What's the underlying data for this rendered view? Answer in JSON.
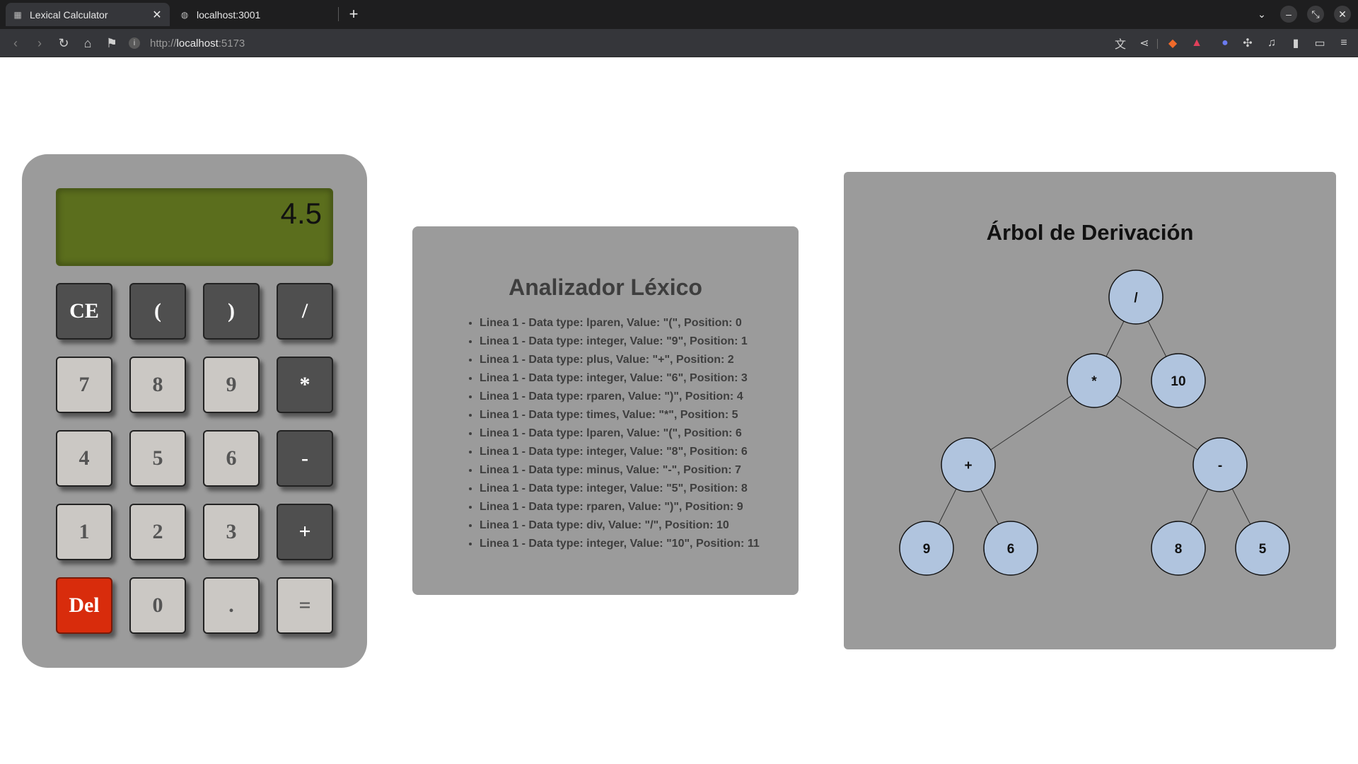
{
  "browser": {
    "tabs": [
      {
        "title": "Lexical Calculator",
        "active": true
      },
      {
        "title": "localhost:3001",
        "active": false
      }
    ],
    "url_prefix": "http://",
    "url_host": "localhost",
    "url_port": ":5173"
  },
  "calculator": {
    "display": "4.5",
    "keys": [
      {
        "label": "CE",
        "style": "dark"
      },
      {
        "label": "(",
        "style": "dark"
      },
      {
        "label": ")",
        "style": "dark"
      },
      {
        "label": "/",
        "style": "dark"
      },
      {
        "label": "7",
        "style": "light"
      },
      {
        "label": "8",
        "style": "light"
      },
      {
        "label": "9",
        "style": "light"
      },
      {
        "label": "*",
        "style": "dark"
      },
      {
        "label": "4",
        "style": "light"
      },
      {
        "label": "5",
        "style": "light"
      },
      {
        "label": "6",
        "style": "light"
      },
      {
        "label": "-",
        "style": "dark"
      },
      {
        "label": "1",
        "style": "light"
      },
      {
        "label": "2",
        "style": "light"
      },
      {
        "label": "3",
        "style": "light"
      },
      {
        "label": "+",
        "style": "dark"
      },
      {
        "label": "Del",
        "style": "red"
      },
      {
        "label": "0",
        "style": "light"
      },
      {
        "label": ".",
        "style": "light"
      },
      {
        "label": "=",
        "style": "light"
      }
    ]
  },
  "lexer": {
    "title": "Analizador Léxico",
    "tokens": [
      "Linea 1 - Data type: lparen, Value: \"(\", Position: 0",
      "Linea 1 - Data type: integer, Value: \"9\", Position: 1",
      "Linea 1 - Data type: plus, Value: \"+\", Position: 2",
      "Linea 1 - Data type: integer, Value: \"6\", Position: 3",
      "Linea 1 - Data type: rparen, Value: \")\", Position: 4",
      "Linea 1 - Data type: times, Value: \"*\", Position: 5",
      "Linea 1 - Data type: lparen, Value: \"(\", Position: 6",
      "Linea 1 - Data type: integer, Value: \"8\", Position: 6",
      "Linea 1 - Data type: minus, Value: \"-\", Position: 7",
      "Linea 1 - Data type: integer, Value: \"5\", Position: 8",
      "Linea 1 - Data type: rparen, Value: \")\", Position: 9",
      "Linea 1 - Data type: div, Value: \"/\", Position: 10",
      "Linea 1 - Data type: integer, Value: \"10\", Position: 11"
    ]
  },
  "tree": {
    "title": "Árbol de Derivación",
    "nodes": [
      {
        "id": "n1",
        "label": "/"
      },
      {
        "id": "n2",
        "label": "*"
      },
      {
        "id": "n3",
        "label": "10"
      },
      {
        "id": "n4",
        "label": "+"
      },
      {
        "id": "n5",
        "label": "-"
      },
      {
        "id": "n6",
        "label": "9"
      },
      {
        "id": "n7",
        "label": "6"
      },
      {
        "id": "n8",
        "label": "8"
      },
      {
        "id": "n9",
        "label": "5"
      }
    ],
    "edges": [
      [
        "n1",
        "n2"
      ],
      [
        "n1",
        "n3"
      ],
      [
        "n2",
        "n4"
      ],
      [
        "n2",
        "n5"
      ],
      [
        "n4",
        "n6"
      ],
      [
        "n4",
        "n7"
      ],
      [
        "n5",
        "n8"
      ],
      [
        "n5",
        "n9"
      ]
    ]
  },
  "colors": {
    "panel": "#9b9b9b",
    "display_bg": "#5b6e1d",
    "node_fill": "#b0c4de",
    "del_key": "#d82c0c"
  }
}
